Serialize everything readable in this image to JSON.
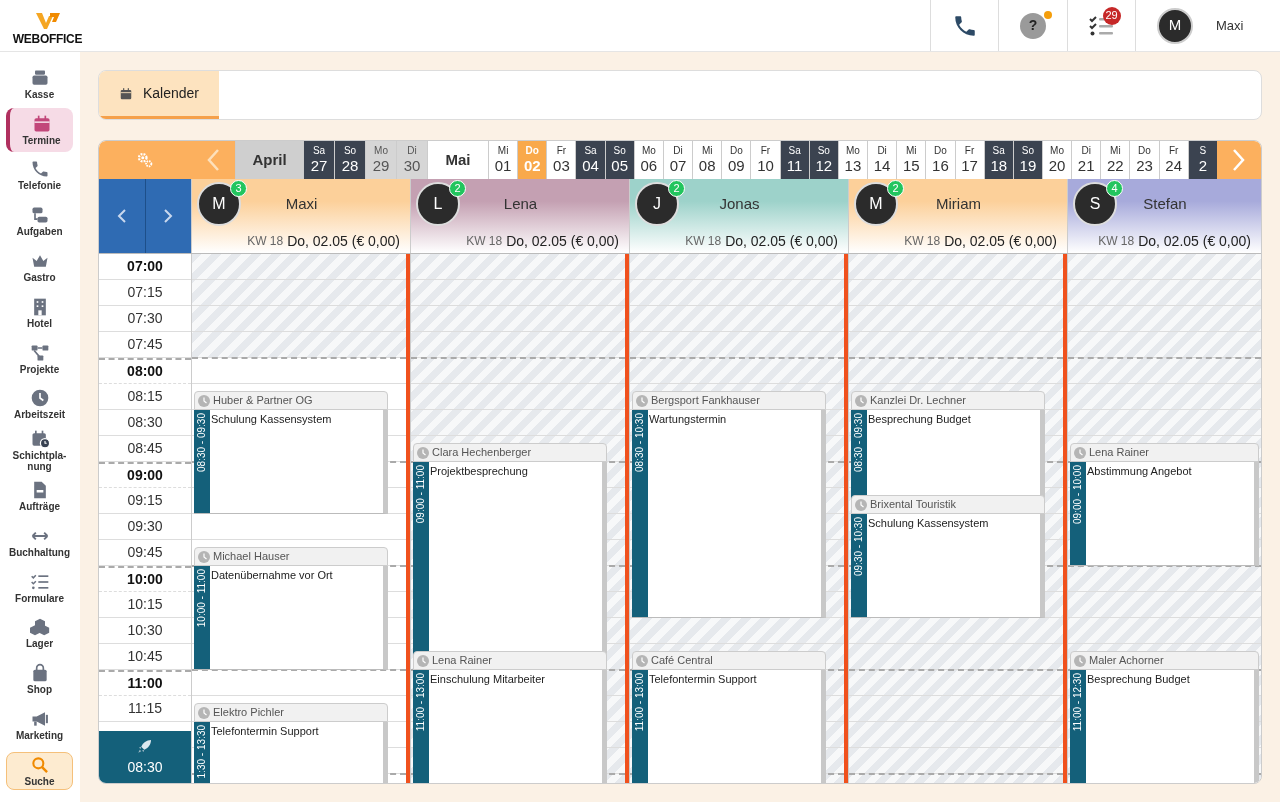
{
  "topbar": {
    "logo": "WEBOFFICE",
    "help": {
      "label": "?",
      "notification": true
    },
    "tasks": {
      "badge": "29"
    },
    "user": {
      "initial": "M",
      "name": "Maxi"
    }
  },
  "sidebar": {
    "items": [
      {
        "label": "Kasse",
        "selected": false,
        "kind": "nav"
      },
      {
        "label": "Termine",
        "selected": true,
        "kind": "nav"
      },
      {
        "label": "Telefonie",
        "selected": false,
        "kind": "nav"
      },
      {
        "label": "Aufgaben",
        "selected": false,
        "kind": "nav"
      },
      {
        "label": "Gastro",
        "selected": false,
        "kind": "nav"
      },
      {
        "label": "Hotel",
        "selected": false,
        "kind": "nav"
      },
      {
        "label": "Projekte",
        "selected": false,
        "kind": "nav"
      },
      {
        "label": "Arbeitszeit",
        "selected": false,
        "kind": "nav"
      },
      {
        "label": "Schichtpla-nung",
        "selected": false,
        "kind": "nav"
      },
      {
        "label": "Aufträge",
        "selected": false,
        "kind": "nav"
      },
      {
        "label": "Buchhaltung",
        "selected": false,
        "kind": "nav"
      },
      {
        "label": "Formulare",
        "selected": false,
        "kind": "nav"
      },
      {
        "label": "Lager",
        "selected": false,
        "kind": "nav"
      },
      {
        "label": "Shop",
        "selected": false,
        "kind": "nav"
      },
      {
        "label": "Marketing",
        "selected": false,
        "kind": "nav"
      },
      {
        "label": "Suche",
        "selected": false,
        "kind": "search"
      }
    ]
  },
  "tabs": [
    {
      "label": "Kalender",
      "selected": true
    }
  ],
  "date_strip": {
    "months": [
      {
        "label": "April",
        "past": true,
        "days": [
          {
            "weekday": "Sa",
            "day": "27",
            "kind": "weekend",
            "selected": false
          },
          {
            "weekday": "So",
            "day": "28",
            "kind": "weekend",
            "selected": false
          },
          {
            "weekday": "Mo",
            "day": "29",
            "kind": "past",
            "selected": false
          },
          {
            "weekday": "Di",
            "day": "30",
            "kind": "past",
            "selected": false
          }
        ]
      },
      {
        "label": "Mai",
        "past": false,
        "days": [
          {
            "weekday": "Mi",
            "day": "01",
            "kind": "weekday",
            "selected": false
          },
          {
            "weekday": "Do",
            "day": "02",
            "kind": "weekday",
            "selected": true
          },
          {
            "weekday": "Fr",
            "day": "03",
            "kind": "weekday",
            "selected": false
          },
          {
            "weekday": "Sa",
            "day": "04",
            "kind": "weekend",
            "selected": false
          },
          {
            "weekday": "So",
            "day": "05",
            "kind": "weekend",
            "selected": false
          },
          {
            "weekday": "Mo",
            "day": "06",
            "kind": "weekday",
            "selected": false
          },
          {
            "weekday": "Di",
            "day": "07",
            "kind": "weekday",
            "selected": false
          },
          {
            "weekday": "Mi",
            "day": "08",
            "kind": "weekday",
            "selected": false
          },
          {
            "weekday": "Do",
            "day": "09",
            "kind": "weekday",
            "selected": false
          },
          {
            "weekday": "Fr",
            "day": "10",
            "kind": "weekday",
            "selected": false
          },
          {
            "weekday": "Sa",
            "day": "11",
            "kind": "weekend",
            "selected": false
          },
          {
            "weekday": "So",
            "day": "12",
            "kind": "weekend",
            "selected": false
          },
          {
            "weekday": "Mo",
            "day": "13",
            "kind": "weekday",
            "selected": false
          },
          {
            "weekday": "Di",
            "day": "14",
            "kind": "weekday",
            "selected": false
          },
          {
            "weekday": "Mi",
            "day": "15",
            "kind": "weekday",
            "selected": false
          },
          {
            "weekday": "Do",
            "day": "16",
            "kind": "weekday",
            "selected": false
          },
          {
            "weekday": "Fr",
            "day": "17",
            "kind": "weekday",
            "selected": false
          },
          {
            "weekday": "Sa",
            "day": "18",
            "kind": "weekend",
            "selected": false
          },
          {
            "weekday": "So",
            "day": "19",
            "kind": "weekend",
            "selected": false
          },
          {
            "weekday": "Mo",
            "day": "20",
            "kind": "weekday",
            "selected": false
          },
          {
            "weekday": "Di",
            "day": "21",
            "kind": "weekday",
            "selected": false
          },
          {
            "weekday": "Mi",
            "day": "22",
            "kind": "weekday",
            "selected": false
          },
          {
            "weekday": "Do",
            "day": "23",
            "kind": "weekday",
            "selected": false
          },
          {
            "weekday": "Fr",
            "day": "24",
            "kind": "weekday",
            "selected": false
          },
          {
            "weekday": "S",
            "day": "2",
            "kind": "weekend",
            "selected": false
          }
        ]
      }
    ]
  },
  "times": [
    {
      "label": "07:00",
      "kind": "hour"
    },
    {
      "label": "07:15",
      "kind": "quarter"
    },
    {
      "label": "07:30",
      "kind": "quarter"
    },
    {
      "label": "07:45",
      "kind": "quarter"
    },
    {
      "label": "08:00",
      "kind": "hour"
    },
    {
      "label": "08:15",
      "kind": "quarter"
    },
    {
      "label": "08:30",
      "kind": "quarter"
    },
    {
      "label": "08:45",
      "kind": "quarter"
    },
    {
      "label": "09:00",
      "kind": "hour"
    },
    {
      "label": "09:15",
      "kind": "quarter"
    },
    {
      "label": "09:30",
      "kind": "quarter"
    },
    {
      "label": "09:45",
      "kind": "quarter"
    },
    {
      "label": "10:00",
      "kind": "hour"
    },
    {
      "label": "10:15",
      "kind": "quarter"
    },
    {
      "label": "10:30",
      "kind": "quarter"
    },
    {
      "label": "10:45",
      "kind": "quarter"
    },
    {
      "label": "11:00",
      "kind": "hour"
    },
    {
      "label": "11:15",
      "kind": "quarter"
    }
  ],
  "now": {
    "time": "08:30"
  },
  "staff": [
    {
      "initial": "M",
      "name": "Maxi",
      "count": "3",
      "color": "#fcd09a",
      "week": "KW 18",
      "date": "Do, 02.05 (€ 0,00)",
      "available": true,
      "events": [
        {
          "client": "Huber & Partner OG",
          "title": "Schulung Kassensystem",
          "time": "08:30 - 09:30"
        },
        {
          "client": "Michael Hauser",
          "title": "Datenübernahme vor Ort",
          "time": "10:00 - 11:00"
        },
        {
          "client": "Elektro Pichler",
          "title": "Telefontermin Support",
          "time": "1:30 - 13:30"
        }
      ]
    },
    {
      "initial": "L",
      "name": "Lena",
      "count": "2",
      "color": "#c4a0b2",
      "week": "KW 18",
      "date": "Do, 02.05 (€ 0,00)",
      "available": false,
      "events": [
        {
          "client": "Clara Hechenberger",
          "title": "Projektbesprechung",
          "time": "09:00 - 11:00"
        },
        {
          "client": "Lena Rainer",
          "title": "Einschulung Mitarbeiter",
          "time": "11:00 - 13:00"
        }
      ]
    },
    {
      "initial": "J",
      "name": "Jonas",
      "count": "2",
      "color": "#9dd2ca",
      "week": "KW 18",
      "date": "Do, 02.05 (€ 0,00)",
      "available": false,
      "events": [
        {
          "client": "Bergsport Fankhauser",
          "title": "Wartungstermin",
          "time": "08:30 - 10:30"
        },
        {
          "client": "Café Central",
          "title": "Telefontermin Support",
          "time": "11:00 - 13:00"
        }
      ]
    },
    {
      "initial": "M",
      "name": "Miriam",
      "count": "2",
      "color": "#fcd09a",
      "week": "KW 18",
      "date": "Do, 02.05 (€ 0,00)",
      "available": false,
      "events": [
        {
          "client": "Kanzlei Dr. Lechner",
          "title": "Besprechung Budget",
          "time": "08:30 - 09:30"
        },
        {
          "client": "Brixental Touristik",
          "title": "Schulung Kassensystem",
          "time": "09:30 - 10:30"
        }
      ]
    },
    {
      "initial": "S",
      "name": "Stefan",
      "count": "4",
      "color": "#a7aadb",
      "week": "KW 18",
      "date": "Do, 02.05 (€ 0,00)",
      "available": false,
      "events": [
        {
          "client": "Lena Rainer",
          "title": "Abstimmung Angebot",
          "time": "09:00 - 10:00"
        },
        {
          "client": "Maler Achorner",
          "title": "Besprechung Budget",
          "time": "11:00 - 12:30"
        }
      ]
    }
  ]
}
